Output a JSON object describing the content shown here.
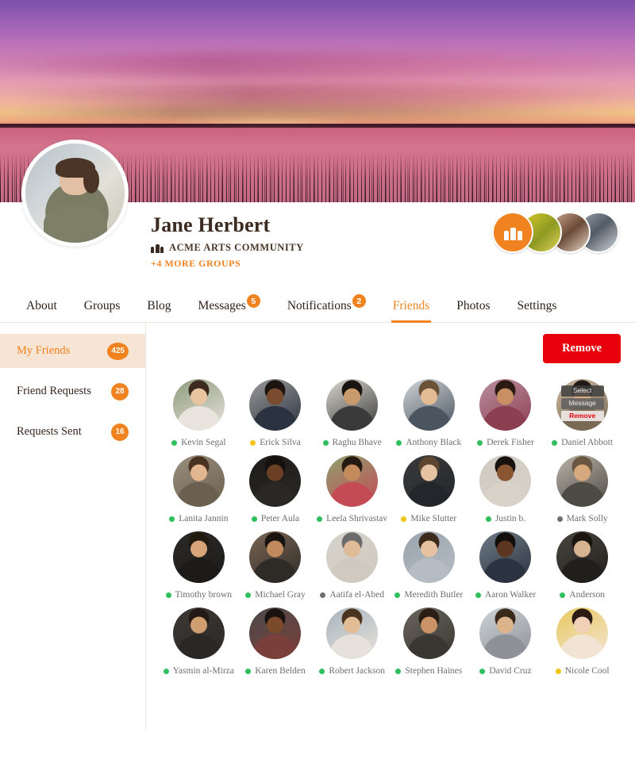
{
  "theme": {
    "accent": "#f0831f",
    "danger": "#e8000d",
    "active_bg": "#f6e5d4",
    "online": "#2fbf5c",
    "away": "#f2c413",
    "offline": "#6f6f6f"
  },
  "profile": {
    "name": "Jane Herbert",
    "group": "ACME ARTS COMMUNITY",
    "more_groups": "+4 MORE GROUPS",
    "group_icon": "people-icon"
  },
  "tabs": [
    {
      "label": "About",
      "badge": null,
      "active": false
    },
    {
      "label": "Groups",
      "badge": null,
      "active": false
    },
    {
      "label": "Blog",
      "badge": null,
      "active": false
    },
    {
      "label": "Messages",
      "badge": "5",
      "active": false
    },
    {
      "label": "Notifications",
      "badge": "2",
      "active": false
    },
    {
      "label": "Friends",
      "badge": null,
      "active": true
    },
    {
      "label": "Photos",
      "badge": null,
      "active": false
    },
    {
      "label": "Settings",
      "badge": null,
      "active": false
    }
  ],
  "sidebar": [
    {
      "label": "My Friends",
      "count": "425",
      "active": true
    },
    {
      "label": "Friend Requests",
      "count": "28",
      "active": false
    },
    {
      "label": "Requests Sent",
      "count": "16",
      "active": false
    }
  ],
  "toolbar": {
    "remove_label": "Remove"
  },
  "hover_menu": {
    "select": "Select",
    "message": "Message",
    "remove": "Remove"
  },
  "friends": [
    {
      "name": "Kevin Segal",
      "status": "online",
      "skin": "#e8c49f",
      "hair": "#3b2a1d",
      "bg": "#8d9b7c",
      "shirt": "#e8e4dd"
    },
    {
      "name": "Erick Silva",
      "status": "away",
      "skin": "#7a4b2e",
      "hair": "#1d1410",
      "bg": "#9a9a9a",
      "shirt": "#2b3240"
    },
    {
      "name": "Raghu Bhave",
      "status": "online",
      "skin": "#c99a6b",
      "hair": "#1a1410",
      "bg": "#d9d6cd",
      "shirt": "#3a3a3a"
    },
    {
      "name": "Anthony Black",
      "status": "online",
      "skin": "#e3bb95",
      "hair": "#6b5136",
      "bg": "#cfd4d6",
      "shirt": "#4b5560"
    },
    {
      "name": "Derek Fisher",
      "status": "online",
      "skin": "#c78f62",
      "hair": "#2a1a12",
      "bg": "#b98fa0",
      "shirt": "#8d3f52"
    },
    {
      "name": "Daniel Abbott",
      "status": "online",
      "skin": "#dcae87",
      "hair": "#1f1a17",
      "bg": "#c8b79d",
      "shirt": "#7a6a55",
      "menu": true
    },
    {
      "name": "Lanita Jannin",
      "status": "online",
      "skin": "#e2b68e",
      "hair": "#4a3220",
      "bg": "#9a8f7e",
      "shirt": "#6b5f4f"
    },
    {
      "name": "Peter Aula",
      "status": "online",
      "skin": "#6b3f24",
      "hair": "#14100d",
      "bg": "#1d1c1a",
      "shirt": "#2a2824"
    },
    {
      "name": "Leela Shrivastav",
      "status": "online",
      "skin": "#c38a5c",
      "hair": "#241a12",
      "bg": "#8fa06f",
      "shirt": "#c44a55"
    },
    {
      "name": "Mike Slutter",
      "status": "away",
      "skin": "#e6c3a2",
      "hair": "#5c4630",
      "bg": "#3a3a3c",
      "shirt": "#23262b"
    },
    {
      "name": "Justin b.",
      "status": "online",
      "skin": "#8a5632",
      "hair": "#17120e",
      "bg": "#cfcac2",
      "shirt": "#d8d2c8"
    },
    {
      "name": "Mark Solly",
      "status": "offline",
      "skin": "#d6a87e",
      "hair": "#6a5540",
      "bg": "#b9b3a8",
      "shirt": "#4e4a44"
    },
    {
      "name": "Timothy brown",
      "status": "online",
      "skin": "#d8a57a",
      "hair": "#22190f",
      "bg": "#2b2a28",
      "shirt": "#1c1b19"
    },
    {
      "name": "Michael Gray",
      "status": "online",
      "skin": "#c08a5c",
      "hair": "#1a1410",
      "bg": "#7a6654",
      "shirt": "#2e2a26"
    },
    {
      "name": "Aatifa el-Abed",
      "status": "offline",
      "skin": "#e0bb97",
      "hair": "#6b6b6b",
      "bg": "#d6d3cc",
      "shirt": "#cfc9bf"
    },
    {
      "name": "Meredith Butler",
      "status": "online",
      "skin": "#e6c2a0",
      "hair": "#3c2a1c",
      "bg": "#9aa3ad",
      "shirt": "#b5bcc4"
    },
    {
      "name": "Aaron Walker",
      "status": "online",
      "skin": "#5c3620",
      "hair": "#120e0b",
      "bg": "#6e7b86",
      "shirt": "#2b3340"
    },
    {
      "name": "Anderson",
      "status": "online",
      "skin": "#d8b392",
      "hair": "#1b1512",
      "bg": "#49453f",
      "shirt": "#211f1c"
    },
    {
      "name": "Yasmin al-Mirza",
      "status": "online",
      "skin": "#cf9f72",
      "hair": "#241a14",
      "bg": "#3d3a36",
      "shirt": "#2a2724"
    },
    {
      "name": "Karen Belden",
      "status": "online",
      "skin": "#7a4a2a",
      "hair": "#181310",
      "bg": "#4a4a4a",
      "shirt": "#7a3f3a"
    },
    {
      "name": "Robert Jackson",
      "status": "online",
      "skin": "#e2bc97",
      "hair": "#4a3420",
      "bg": "#a8b4bd",
      "shirt": "#e6e2db"
    },
    {
      "name": "Stephen Haines",
      "status": "online",
      "skin": "#c99367",
      "hair": "#2a1d14",
      "bg": "#6a665e",
      "shirt": "#3a3631"
    },
    {
      "name": "David Cruz",
      "status": "online",
      "skin": "#dcb48c",
      "hair": "#3a2a1c",
      "bg": "#cdd2d6",
      "shirt": "#8e9298"
    },
    {
      "name": "Nicole Cool",
      "status": "away",
      "skin": "#f0d0b6",
      "hair": "#2a1c14",
      "bg": "#e8c95e",
      "shirt": "#f2e4d4"
    }
  ]
}
